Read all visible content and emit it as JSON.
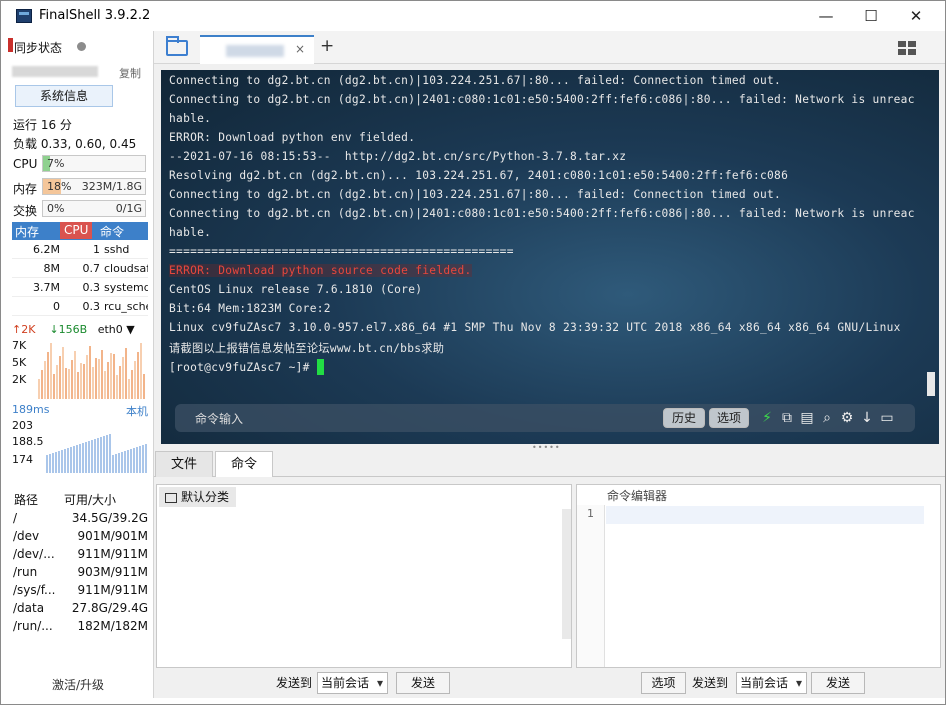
{
  "window": {
    "title": "FinalShell 3.9.2.2",
    "minimize": "—",
    "maximize": "☐",
    "close": "✕"
  },
  "sidebar": {
    "sync_label": "同步状态",
    "copy_label": "复制",
    "sysinfo_button": "系统信息",
    "running": "运行 16 分",
    "load": "负载 0.33, 0.60, 0.45",
    "metrics": [
      {
        "label": "CPU",
        "value": "7%",
        "right": "",
        "fraction": 0.07,
        "color": "#8fd18f"
      },
      {
        "label": "内存",
        "value": "18%",
        "right": "323M/1.8G",
        "fraction": 0.18,
        "color": "#f4c69a"
      },
      {
        "label": "交换",
        "value": "0%",
        "right": "0/1G",
        "fraction": 0.0,
        "color": "#8fd18f"
      }
    ],
    "process_headers": {
      "mem": "内存",
      "cpu": "CPU",
      "cmd": "命令"
    },
    "processes": [
      {
        "mem": "6.2M",
        "cpu": "1",
        "cmd": "sshd"
      },
      {
        "mem": "8M",
        "cpu": "0.7",
        "cmd": "cloudsaf"
      },
      {
        "mem": "3.7M",
        "cpu": "0.3",
        "cmd": "systemd"
      },
      {
        "mem": "0",
        "cpu": "0.3",
        "cmd": "rcu_sche"
      }
    ],
    "net": {
      "up": "↑2K",
      "down": "↓156B",
      "iface": "eth0 ▼",
      "ticks": [
        "7K",
        "5K",
        "2K"
      ]
    },
    "latency": {
      "ms": "189ms",
      "host": "本机",
      "ticks": [
        "203",
        "188.5",
        "174"
      ]
    },
    "disk_headers": {
      "path": "路径",
      "avail": "可用/大小"
    },
    "disks": [
      {
        "path": "/",
        "value": "34.5G/39.2G"
      },
      {
        "path": "/dev",
        "value": "901M/901M"
      },
      {
        "path": "/dev/...",
        "value": "911M/911M"
      },
      {
        "path": "/run",
        "value": "903M/911M"
      },
      {
        "path": "/sys/f...",
        "value": "911M/911M"
      },
      {
        "path": "/data",
        "value": "27.8G/29.4G"
      },
      {
        "path": "/run/...",
        "value": "182M/182M"
      }
    ],
    "activate": "激活/升级"
  },
  "tabs": {
    "plus": "+",
    "close": "×"
  },
  "terminal": {
    "lines": [
      "Connecting to dg2.bt.cn (dg2.bt.cn)|103.224.251.67|:80... failed: Connection timed out.",
      "Connecting to dg2.bt.cn (dg2.bt.cn)|2401:c080:1c01:e50:5400:2ff:fef6:c086|:80... failed: Network is unreac",
      "hable.",
      "ERROR: Download python env fielded.",
      "--2021-07-16 08:15:53--  http://dg2.bt.cn/src/Python-3.7.8.tar.xz",
      "Resolving dg2.bt.cn (dg2.bt.cn)... 103.224.251.67, 2401:c080:1c01:e50:5400:2ff:fef6:c086",
      "Connecting to dg2.bt.cn (dg2.bt.cn)|103.224.251.67|:80... failed: Connection timed out.",
      "Connecting to dg2.bt.cn (dg2.bt.cn)|2401:c080:1c01:e50:5400:2ff:fef6:c086|:80... failed: Network is unreac",
      "hable.",
      "=================================================",
      "ERROR: Download python source code fielded.",
      "CentOS Linux release 7.6.1810 (Core)",
      "Bit:64 Mem:1823M Core:2",
      "Linux cv9fuZAsc7 3.10.0-957.el7.x86_64 #1 SMP Thu Nov 8 23:39:32 UTC 2018 x86_64 x86_64 x86_64 GNU/Linux",
      "请截图以上报错信息发帖至论坛www.bt.cn/bbs求助",
      "[root@cv9fuZAsc7 ~]# "
    ],
    "error_line_index": 10,
    "cmd_placeholder": "命令输入",
    "history_button": "历史",
    "options_button": "选项"
  },
  "bottom": {
    "tab_files": "文件",
    "tab_commands": "命令",
    "default_category": "默认分类",
    "editor_title": "命令编辑器",
    "line_number": "1",
    "send_to": "发送到",
    "current_session": "当前会话",
    "send": "发送",
    "options": "选项"
  }
}
